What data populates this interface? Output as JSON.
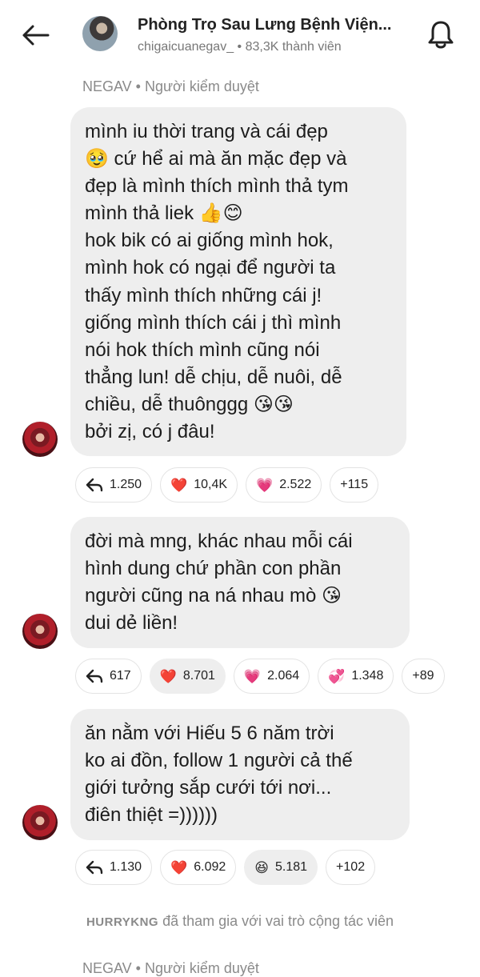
{
  "header": {
    "title": "Phòng Trọ Sau Lưng Bệnh Viện...",
    "subtitle": "chigaicuanegav_ • 83,3K thành viên"
  },
  "messages": [
    {
      "sender": "NEGAV • Người kiểm duyệt",
      "text": "mình iu thời trang và cái đẹp\n🥹 cứ hể ai mà ăn mặc đẹp và\nđẹp là mình thích mình thả tym\nmình thả liek 👍😊\nhok bik có ai giống mình hok,\nmình hok có ngại để người ta\nthấy mình thích những cái j!\ngiống mình thích cái j thì mình\nnói hok thích mình cũng nói\nthẳng lun! dễ chịu, dễ nuôi, dễ\nchiều, dễ thuônggg 😘😘\nbởi zị, có j đâu!",
      "reactions": [
        {
          "icon": "reply-icon",
          "emoji": "",
          "count": "1.250"
        },
        {
          "icon": "heart-icon",
          "emoji": "❤️",
          "count": "10,4K"
        },
        {
          "icon": "sparkling-heart-icon",
          "emoji": "💗",
          "count": "2.522"
        },
        {
          "icon": "",
          "emoji": "",
          "count": "+115"
        }
      ]
    },
    {
      "text": "đời mà mng, khác nhau mỗi cái\nhình dung chứ phần con phần\nngười cũng na ná nhau mò 😘\ndui dẻ liền!",
      "reactions": [
        {
          "icon": "reply-icon",
          "emoji": "",
          "count": "617"
        },
        {
          "icon": "heart-icon",
          "emoji": "❤️",
          "count": "8.701"
        },
        {
          "icon": "sparkling-heart-icon",
          "emoji": "💗",
          "count": "2.064"
        },
        {
          "icon": "revolving-hearts-icon",
          "emoji": "💞",
          "count": "1.348"
        },
        {
          "icon": "",
          "emoji": "",
          "count": "+89"
        }
      ]
    },
    {
      "text": "ăn nằm với Hiếu 5 6 năm trời\nko ai đồn, follow 1 người cả thế\ngiới tưởng sắp cưới tới nơi...\nđiên thiệt =))))))",
      "reactions": [
        {
          "icon": "reply-icon",
          "emoji": "",
          "count": "1.130"
        },
        {
          "icon": "heart-icon",
          "emoji": "❤️",
          "count": "6.092"
        },
        {
          "icon": "laughing-icon",
          "emoji": "😆",
          "count": "5.181"
        },
        {
          "icon": "",
          "emoji": "",
          "count": "+102"
        }
      ]
    }
  ],
  "system_notice": {
    "username": "HURRYKNG",
    "text": "đã tham gia với vai trò cộng tác viên"
  },
  "next_sender": "NEGAV • Người kiểm duyệt"
}
